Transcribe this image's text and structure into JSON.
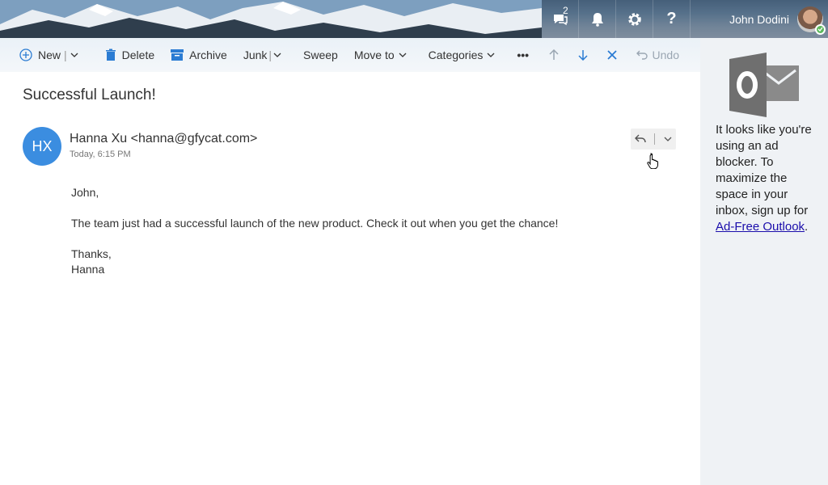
{
  "header": {
    "notifications_badge": "2",
    "user_name": "John Dodini",
    "help_label": "?"
  },
  "toolbar": {
    "new_label": "New",
    "delete_label": "Delete",
    "archive_label": "Archive",
    "junk_label": "Junk",
    "sweep_label": "Sweep",
    "move_to_label": "Move to",
    "categories_label": "Categories",
    "more_label": "•••",
    "undo_label": "Undo"
  },
  "message": {
    "subject": "Successful Launch!",
    "sender_initials": "HX",
    "sender": "Hanna Xu <hanna@gfycat.com>",
    "date": "Today, 6:15 PM",
    "greeting": "John,",
    "body": "The team just had a successful launch of the new product. Check it out when you get the chance!",
    "closing": "Thanks,",
    "signature": "Hanna"
  },
  "ad_pane": {
    "text": "It looks like you're using an ad blocker. To maximize the space in your inbox, sign up for",
    "link_text": "Ad-Free Outlook",
    "period": "."
  },
  "colors": {
    "avatar_blue": "#3b8de0",
    "accent_blue": "#2b7cd3",
    "link": "#1a0dab"
  }
}
